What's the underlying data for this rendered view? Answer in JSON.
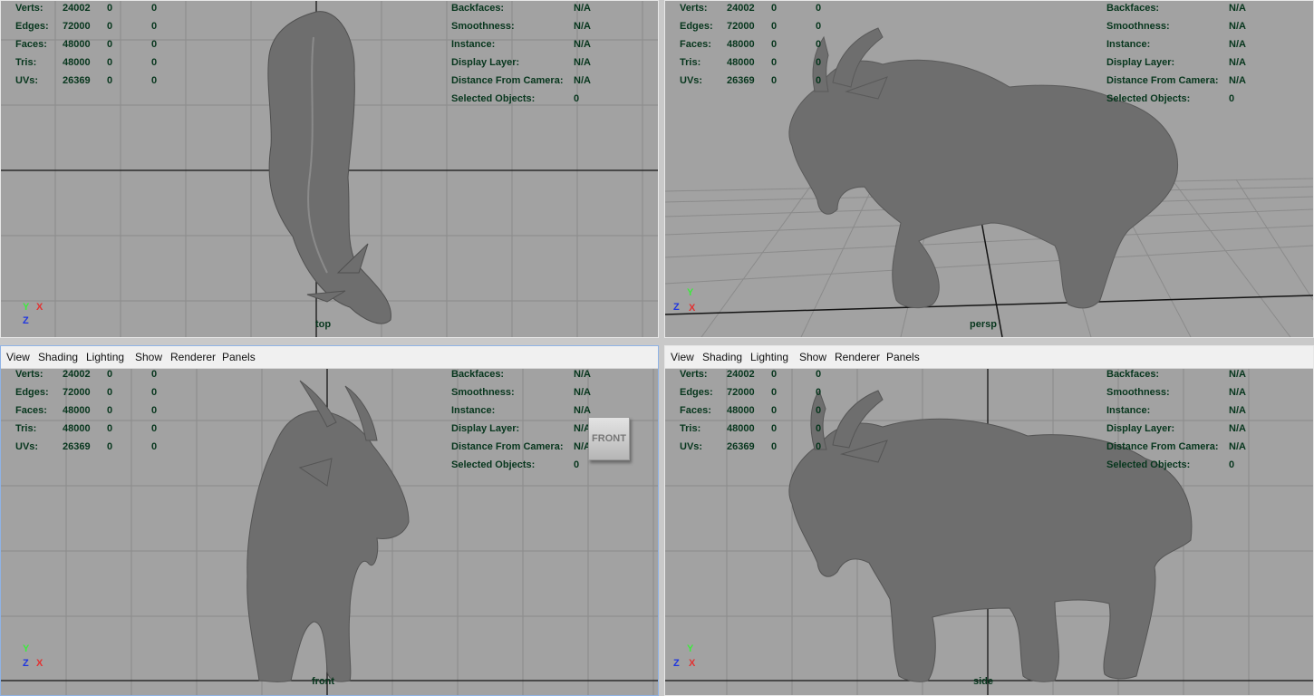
{
  "menu": [
    "View",
    "Shading",
    "Lighting",
    "Show",
    "Renderer",
    "Panels"
  ],
  "hud_left": [
    {
      "label": "Verts:",
      "v1": "24002",
      "v2": "0",
      "v3": "0"
    },
    {
      "label": "Edges:",
      "v1": "72000",
      "v2": "0",
      "v3": "0"
    },
    {
      "label": "Faces:",
      "v1": "48000",
      "v2": "0",
      "v3": "0"
    },
    {
      "label": "Tris:",
      "v1": "48000",
      "v2": "0",
      "v3": "0"
    },
    {
      "label": "UVs:",
      "v1": "26369",
      "v2": "0",
      "v3": "0"
    }
  ],
  "hud_right": [
    {
      "label": "Backfaces:",
      "value": "N/A"
    },
    {
      "label": "Smoothness:",
      "value": "N/A"
    },
    {
      "label": "Instance:",
      "value": "N/A"
    },
    {
      "label": "Display Layer:",
      "value": "N/A"
    },
    {
      "label": "Distance From Camera:",
      "value": "N/A"
    },
    {
      "label": "Selected Objects:",
      "value": "0"
    }
  ],
  "viewports": [
    {
      "id": "top",
      "camera": "top",
      "axes": {
        "a": "Y",
        "b": "X",
        "c": "Z"
      },
      "active": false
    },
    {
      "id": "persp",
      "camera": "persp",
      "axes": {
        "a": "Y",
        "b": "Z",
        "c": "X"
      },
      "active": false
    },
    {
      "id": "front",
      "camera": "front",
      "axes": {
        "a": "Y",
        "b": "Z",
        "c": "X"
      },
      "active": true,
      "view_cube": "FRONT"
    },
    {
      "id": "side",
      "camera": "side",
      "axes": {
        "a": "Y",
        "b": "Z",
        "c": "X"
      },
      "active": false
    }
  ],
  "colors": {
    "viewport_bg": "#a2a2a2",
    "grid": "#8b8b8b",
    "axis_line": "#141414",
    "hud_text": "#07361d",
    "model": "#6e6e6e",
    "active_border": "#8fb3e6"
  }
}
